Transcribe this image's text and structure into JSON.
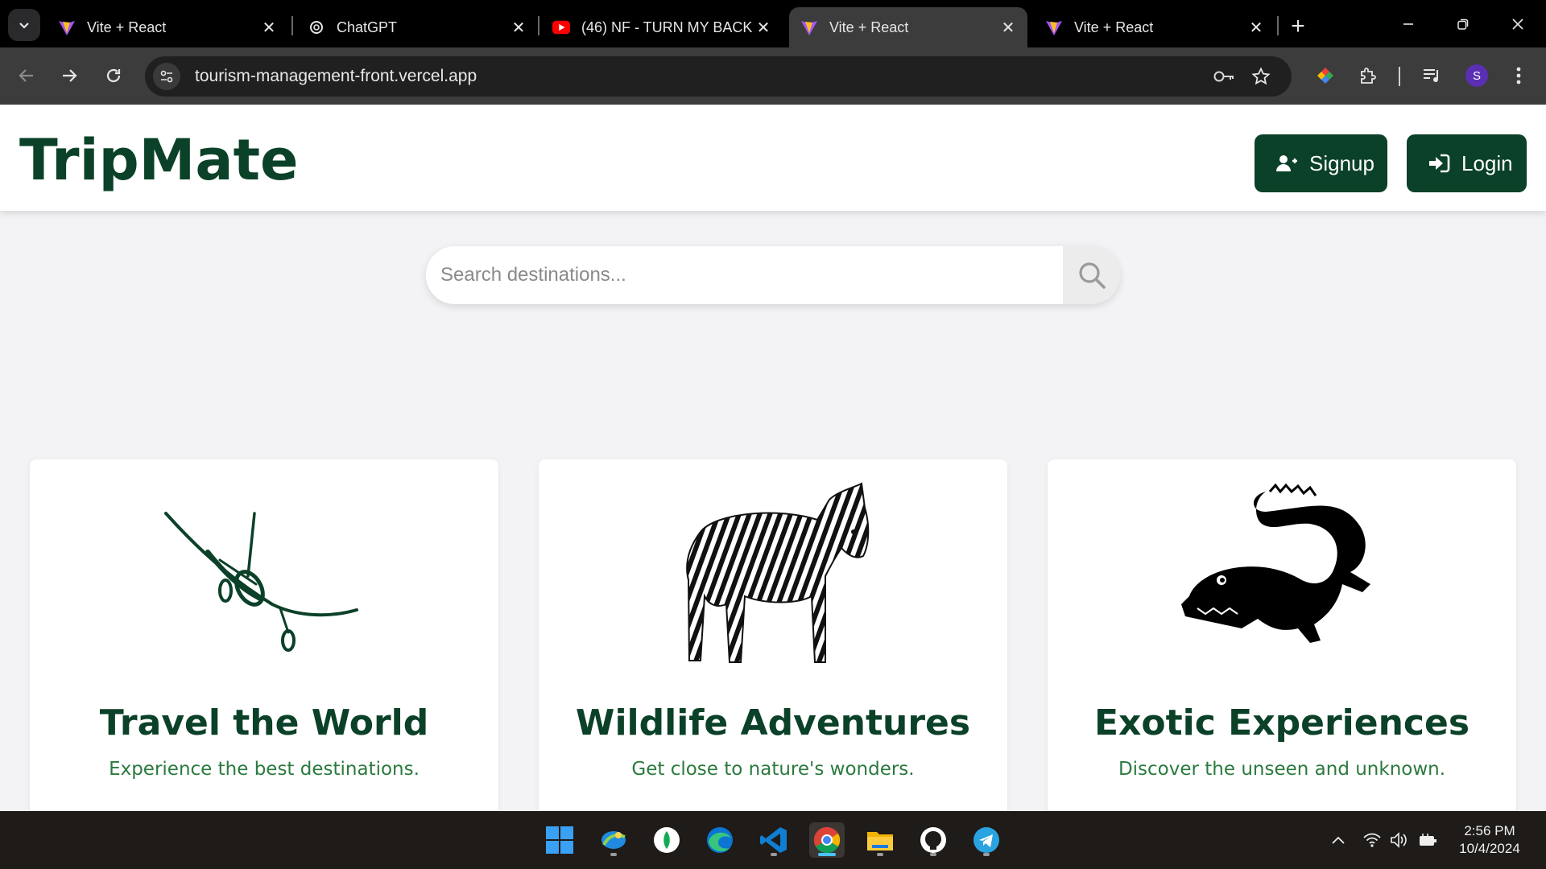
{
  "browser": {
    "tabs": [
      {
        "title": "Vite + React",
        "favicon": "vite-icon",
        "active": false
      },
      {
        "title": "ChatGPT",
        "favicon": "chatgpt-icon",
        "active": false
      },
      {
        "title": "(46) NF - TURN MY BACK",
        "favicon": "youtube-icon",
        "active": false
      },
      {
        "title": "Vite + React",
        "favicon": "vite-icon",
        "active": true
      },
      {
        "title": "Vite + React",
        "favicon": "vite-icon",
        "active": false
      }
    ],
    "close_glyph": "✕",
    "new_tab_glyph": "+",
    "url": "tourism-management-front.vercel.app",
    "profile_initial": "S"
  },
  "header": {
    "brand": "TripMate",
    "signup_label": "Signup",
    "login_label": "Login"
  },
  "search": {
    "placeholder": "Search destinations..."
  },
  "cards": [
    {
      "title": "Travel the World",
      "subtitle": "Experience the best destinations.",
      "art": "airplane-illustration"
    },
    {
      "title": "Wildlife Adventures",
      "subtitle": "Get close to nature's wonders.",
      "art": "zebra-illustration"
    },
    {
      "title": "Exotic Experiences",
      "subtitle": "Discover the unseen and unknown.",
      "art": "crocodile-illustration"
    }
  ],
  "taskbar": {
    "apps": [
      "windows-start-icon",
      "photos-icon",
      "mongodb-compass-icon",
      "edge-icon",
      "vscode-icon",
      "chrome-icon",
      "file-explorer-icon",
      "github-desktop-icon",
      "telegram-icon"
    ],
    "time": "2:56 PM",
    "date": "10/4/2024"
  },
  "colors": {
    "brand_green": "#0b4128",
    "subtitle_green": "#2b7a3e",
    "page_bg": "#f3f3f5",
    "chrome_dark": "#3c3c3c"
  }
}
